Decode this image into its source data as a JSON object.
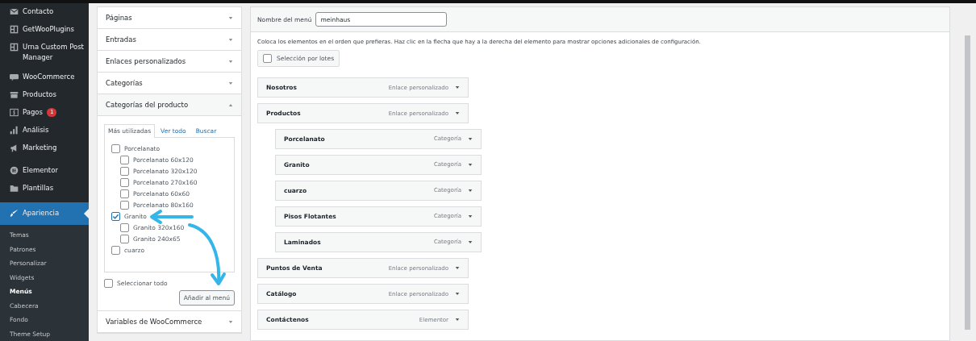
{
  "sidebar": {
    "items": [
      {
        "label": "Contacto",
        "selected": false
      },
      {
        "label": "GetWooPlugins",
        "selected": false
      },
      {
        "label": "Urna Custom Post Manager",
        "selected": false
      },
      {
        "label": "WooCommerce",
        "selected": false
      },
      {
        "label": "Productos",
        "selected": false
      },
      {
        "label": "Pagos",
        "selected": false,
        "badge": "1"
      },
      {
        "label": "Análisis",
        "selected": false
      },
      {
        "label": "Marketing",
        "selected": false
      },
      {
        "label": "Elementor",
        "selected": false
      },
      {
        "label": "Plantillas",
        "selected": false
      },
      {
        "label": "Apariencia",
        "selected": true
      }
    ],
    "submenu": [
      {
        "label": "Temas",
        "selected": false
      },
      {
        "label": "Patrones",
        "selected": false
      },
      {
        "label": "Personalizar",
        "selected": false
      },
      {
        "label": "Widgets",
        "selected": false
      },
      {
        "label": "Menús",
        "selected": true
      },
      {
        "label": "Cabecera",
        "selected": false
      },
      {
        "label": "Fondo",
        "selected": false
      },
      {
        "label": "Theme Setup",
        "selected": false
      }
    ]
  },
  "sections": [
    {
      "title": "Páginas",
      "expanded": false
    },
    {
      "title": "Entradas",
      "expanded": false
    },
    {
      "title": "Enlaces personalizados",
      "expanded": false
    },
    {
      "title": "Categorías",
      "expanded": false
    },
    {
      "title": "Categorías del producto",
      "expanded": true,
      "tabs": [
        {
          "label": "Más utilizadas",
          "selected": true
        },
        {
          "label": "Ver todo",
          "selected": false
        },
        {
          "label": "Buscar",
          "selected": false
        }
      ],
      "items": [
        {
          "label": "Porcelanato",
          "checked": false,
          "children": [
            {
              "label": "Porcelanato 60x120",
              "checked": false
            },
            {
              "label": "Porcelanato 320x120",
              "checked": false
            },
            {
              "label": "Porcelanato 270x160",
              "checked": false
            },
            {
              "label": "Porcelanato 60x60",
              "checked": false
            },
            {
              "label": "Porcelanato 80x160",
              "checked": false
            }
          ]
        },
        {
          "label": "Granito",
          "checked": true,
          "children": [
            {
              "label": "Granito 320x160",
              "checked": false
            },
            {
              "label": "Granito 240x65",
              "checked": false
            }
          ]
        },
        {
          "label": "cuarzo",
          "checked": false
        }
      ],
      "select_all": {
        "label": "Seleccionar todo",
        "checked": false
      },
      "button": "Añadir al menú"
    },
    {
      "title": "Variables de WooCommerce",
      "expanded": false
    }
  ],
  "menu_name": {
    "label": "Nombre del menú",
    "value": "meinhaus"
  },
  "instructions": "Coloca los elementos en el orden que prefieras. Haz clic en la flecha que hay a la derecha del elemento para mostrar opciones adicionales de configuración.",
  "bulk_select": {
    "label": "Selección por lotes",
    "checked": false
  },
  "menu_items": [
    {
      "title": "Nosotros",
      "type": "Enlace personalizado"
    },
    {
      "title": "Productos",
      "type": "Enlace personalizado",
      "children": [
        {
          "title": "Porcelanato",
          "type": "Categoría"
        },
        {
          "title": "Granito",
          "type": "Categoría"
        },
        {
          "title": "cuarzo",
          "type": "Categoría"
        },
        {
          "title": "Pisos Flotantes",
          "type": "Categoría"
        },
        {
          "title": "Laminados",
          "type": "Categoría"
        }
      ]
    },
    {
      "title": "Puntos de Venta",
      "type": "Enlace personalizado"
    },
    {
      "title": "Catálogo",
      "type": "Enlace personalizado"
    },
    {
      "title": "Contáctenos",
      "type": "Elementor"
    }
  ]
}
